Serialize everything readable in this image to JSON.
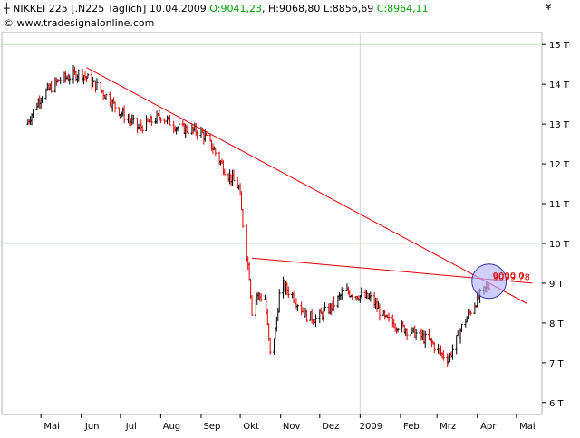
{
  "header": {
    "marker": "┼",
    "instrument": "NIKKEI 225 [.N225 Täglich]",
    "date": "10.04.2009",
    "open": "O:9041,23",
    "high": "H:9068,80",
    "low": "L:8856,69",
    "close": "C:8964,11",
    "source": "© www.tradesignalonline.com",
    "currency": "¥"
  },
  "colors": {
    "background": "#ffffff",
    "up_bar": "#000000",
    "down_bar": "#e00000",
    "trendline": "#dd0000",
    "grid": "#c8dcc8",
    "circle_fill": "#b4b4ff",
    "circle_stroke": "#3030a0"
  },
  "chart_data": {
    "type": "line",
    "subtype": "ohlc-bars",
    "title": "NIKKEI 225 [.N225 Täglich] 10.04.2009",
    "x_tick_labels": [
      "Mai",
      "Jun",
      "Jul",
      "Aug",
      "Sep",
      "Okt",
      "Nov",
      "Dez",
      "2009",
      "Feb",
      "Mrz",
      "Apr",
      "Mai"
    ],
    "y_tick_labels": [
      "6 T",
      "7 T",
      "8 T",
      "9 T",
      "10 T",
      "11 T",
      "12 T",
      "13 T",
      "14 T",
      "15 T"
    ],
    "ylim": [
      5700,
      15300
    ],
    "y_scale": "linear",
    "y_axis_position": "right",
    "grid": {
      "horizontal_major_at": [
        10000,
        15000
      ],
      "vertical_at": [
        "2009"
      ]
    },
    "series": [
      {
        "name": "NIKKEI 225",
        "x": [
          "2008-04-20",
          "2008-05-01",
          "2008-05-15",
          "2008-06-01",
          "2008-06-07",
          "2008-06-15",
          "2008-07-01",
          "2008-07-15",
          "2008-08-01",
          "2008-08-15",
          "2008-09-01",
          "2008-09-10",
          "2008-09-20",
          "2008-09-30",
          "2008-10-03",
          "2008-10-08",
          "2008-10-10",
          "2008-10-14",
          "2008-10-20",
          "2008-10-24",
          "2008-10-28",
          "2008-11-01",
          "2008-11-10",
          "2008-11-20",
          "2008-11-28",
          "2008-12-10",
          "2008-12-20",
          "2008-12-30",
          "2009-01-10",
          "2009-01-20",
          "2009-02-01",
          "2009-02-15",
          "2009-02-25",
          "2009-03-05",
          "2009-03-10",
          "2009-03-20",
          "2009-03-25",
          "2009-04-01",
          "2009-04-10"
        ],
        "values": [
          13000,
          13700,
          14100,
          14300,
          14100,
          13900,
          13300,
          12900,
          13200,
          12900,
          12800,
          12400,
          11800,
          11400,
          10500,
          9200,
          8300,
          8700,
          8600,
          7200,
          7800,
          9000,
          8700,
          8200,
          8100,
          8400,
          8800,
          8700,
          8600,
          8100,
          7900,
          7700,
          7500,
          7200,
          7100,
          7900,
          8200,
          8600,
          8964
        ],
        "high": [
          13200,
          13900,
          14300,
          14500,
          14300,
          14100,
          13500,
          13200,
          13400,
          13100,
          13000,
          12600,
          12100,
          11700,
          11000,
          9800,
          8700,
          9500,
          9100,
          7700,
          8300,
          9500,
          9000,
          8500,
          8400,
          8700,
          9000,
          9300,
          8900,
          8300,
          8100,
          7900,
          7700,
          7400,
          7300,
          8100,
          8500,
          9000,
          9069
        ],
        "low": [
          12800,
          13400,
          13800,
          14000,
          13800,
          13600,
          13000,
          12700,
          12900,
          12600,
          12500,
          12100,
          11400,
          11000,
          9800,
          8100,
          8000,
          8200,
          8200,
          7000,
          7500,
          8600,
          8400,
          7900,
          7800,
          8100,
          8500,
          8400,
          8200,
          7800,
          7700,
          7500,
          7200,
          7000,
          7050,
          7600,
          8000,
          8400,
          8857
        ],
        "color": "#000000"
      },
      {
        "name": "Trendlinie 1",
        "x": [
          "2008-06-05",
          "2009-04-10"
        ],
        "values": [
          14420,
          9000
        ],
        "color": "#dd0000"
      },
      {
        "name": "Trendlinie 2",
        "x": [
          "2008-10-10",
          "2009-04-10"
        ],
        "values": [
          9630,
          9099
        ],
        "color": "#dd0000"
      }
    ],
    "annotations": [
      {
        "label_1": "9099,78",
        "label_2": "9000,0",
        "x": "2009-04-10",
        "values": [
          9099.78,
          9000.0
        ]
      }
    ]
  }
}
